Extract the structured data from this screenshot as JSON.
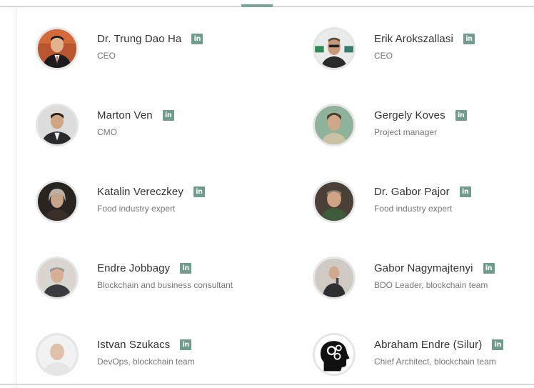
{
  "team": {
    "members": [
      {
        "name": "Dr. Trung Dao Ha",
        "role": "CEO",
        "linkedin": "in",
        "avatar_icon": "person-photo"
      },
      {
        "name": "Erik Arokszallasi",
        "role": "CEO",
        "linkedin": "in",
        "avatar_icon": "person-photo"
      },
      {
        "name": "Marton Ven",
        "role": "CMO",
        "linkedin": "in",
        "avatar_icon": "person-photo"
      },
      {
        "name": "Gergely Koves",
        "role": "Project manager",
        "linkedin": "in",
        "avatar_icon": "person-photo"
      },
      {
        "name": "Katalin Vereczkey",
        "role": "Food industry expert",
        "linkedin": "in",
        "avatar_icon": "person-photo"
      },
      {
        "name": "Dr. Gabor Pajor",
        "role": "Food industry expert",
        "linkedin": "in",
        "avatar_icon": "person-photo"
      },
      {
        "name": "Endre Jobbagy",
        "role": "Blockchain and business consultant",
        "linkedin": "in",
        "avatar_icon": "person-photo"
      },
      {
        "name": "Gabor Nagymajtenyi",
        "role": "BDO Leader, blockchain team",
        "linkedin": "in",
        "avatar_icon": "person-photo"
      },
      {
        "name": "Istvan Szukacs",
        "role": "DevOps, blockchain team",
        "linkedin": "in",
        "avatar_icon": "person-photo"
      },
      {
        "name": "Abraham Endre (Silur)",
        "role": "Chief Architect, blockchain team",
        "linkedin": "in",
        "avatar_icon": "head-gears-icon"
      }
    ]
  },
  "colors": {
    "linkedin_badge": "#6f9c8e",
    "name_text": "#333333",
    "role_text": "#777777",
    "avatar_border": "#e6e6e6"
  }
}
